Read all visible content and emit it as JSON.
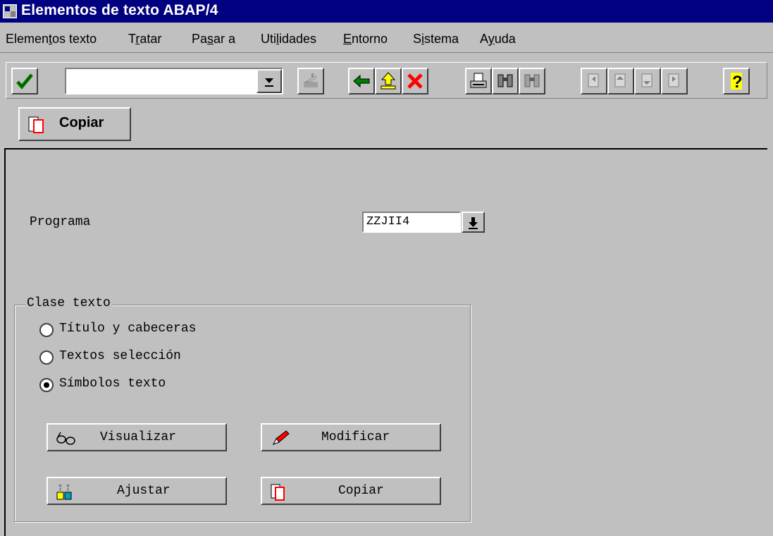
{
  "window": {
    "title": "Elementos de texto ABAP/4"
  },
  "menu": {
    "items": [
      {
        "pre": "Elemen",
        "key": "t",
        "post": "os texto"
      },
      {
        "pre": "T",
        "key": "r",
        "post": "atar"
      },
      {
        "pre": "Pa",
        "key": "s",
        "post": "ar a"
      },
      {
        "pre": "Uti",
        "key": "l",
        "post": "idades"
      },
      {
        "pre": "",
        "key": "E",
        "post": "ntorno"
      },
      {
        "pre": "S",
        "key": "i",
        "post": "stema"
      },
      {
        "pre": "A",
        "key": "y",
        "post": "uda"
      }
    ]
  },
  "toolbar": {
    "command_value": "",
    "icons": [
      "enter-icon",
      "save-icon",
      "back-icon",
      "exit-icon",
      "cancel-icon",
      "print-icon",
      "find-icon",
      "find-next-icon",
      "first-page-icon",
      "previous-page-icon",
      "next-page-icon",
      "last-page-icon",
      "help-icon"
    ]
  },
  "appbar": {
    "copy_label": "Copiar"
  },
  "form": {
    "program_label": "Programa",
    "program_value": "ZZJII4",
    "group_title": "Clase texto",
    "radios": [
      {
        "label": "Título y cabeceras",
        "checked": false
      },
      {
        "label": "Textos selección",
        "checked": false
      },
      {
        "label": "Símbolos texto",
        "checked": true
      }
    ],
    "buttons": {
      "display": "Visualizar",
      "change": "Modificar",
      "adjust": "Ajustar",
      "copy": "Copiar"
    }
  }
}
